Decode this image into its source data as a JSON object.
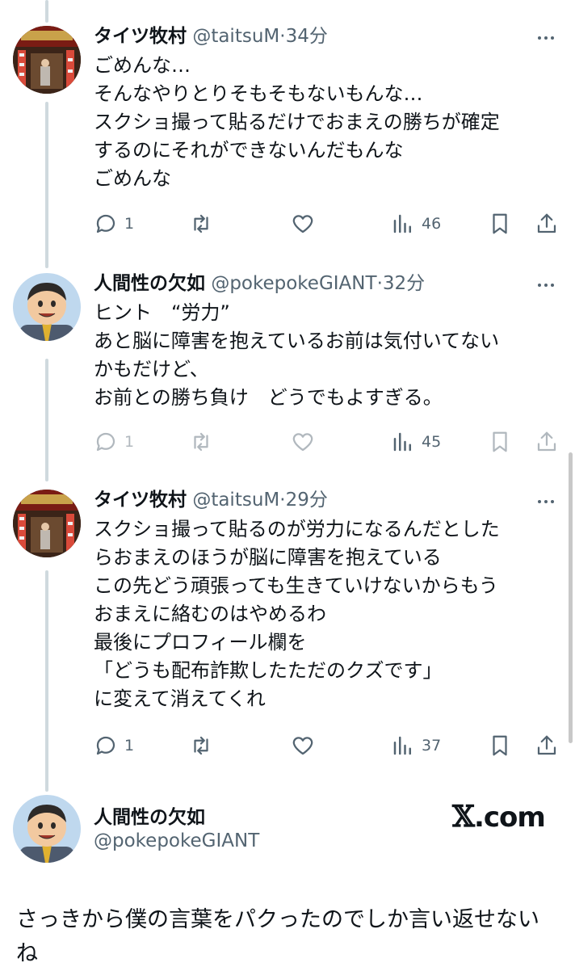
{
  "tweets": [
    {
      "name": "タイツ牧村",
      "handle": "@taitsuM",
      "time": "34分",
      "text": "ごめんな…\nそんなやりとりそもそもないもんな…\nスクショ撮って貼るだけでおまえの勝ちが確定\nするのにそれができないんだもんな\nごめんな",
      "replies": "1",
      "views": "46"
    },
    {
      "name": "人間性の欠如",
      "handle": "@pokepokeGIANT",
      "time": "32分",
      "text": "ヒント　“労力”\nあと脳に障害を抱えているお前は気付いてない\nかもだけど、\nお前との勝ち負け　どうでもよすぎる。",
      "replies": "1",
      "views": "45"
    },
    {
      "name": "タイツ牧村",
      "handle": "@taitsuM",
      "time": "29分",
      "text": "スクショ撮って貼るのが労力になるんだとした\nらおまえのほうが脳に障害を抱えている\nこの先どう頑張っても生きていけないからもう\nおまえに絡むのはやめるわ\n最後にプロフィール欄を\n「どうも配布詐欺したただのクズです」\nに変えて消えてくれ",
      "replies": "1",
      "views": "37"
    }
  ],
  "separator": "·",
  "quoted": {
    "name": "人間性の欠如",
    "handle": "@pokepokeGIANT",
    "site": ".com",
    "site_mark": "𝕏",
    "text": "さっきから僕の言葉をパクったのでしか言い返せないね"
  },
  "colors": {
    "text": "#0f1419",
    "secondary": "#536471",
    "thread_line": "#cfd9de"
  },
  "icons": [
    "reply-icon",
    "retweet-icon",
    "like-icon",
    "views-icon",
    "bookmark-icon",
    "share-icon",
    "more-icon"
  ]
}
